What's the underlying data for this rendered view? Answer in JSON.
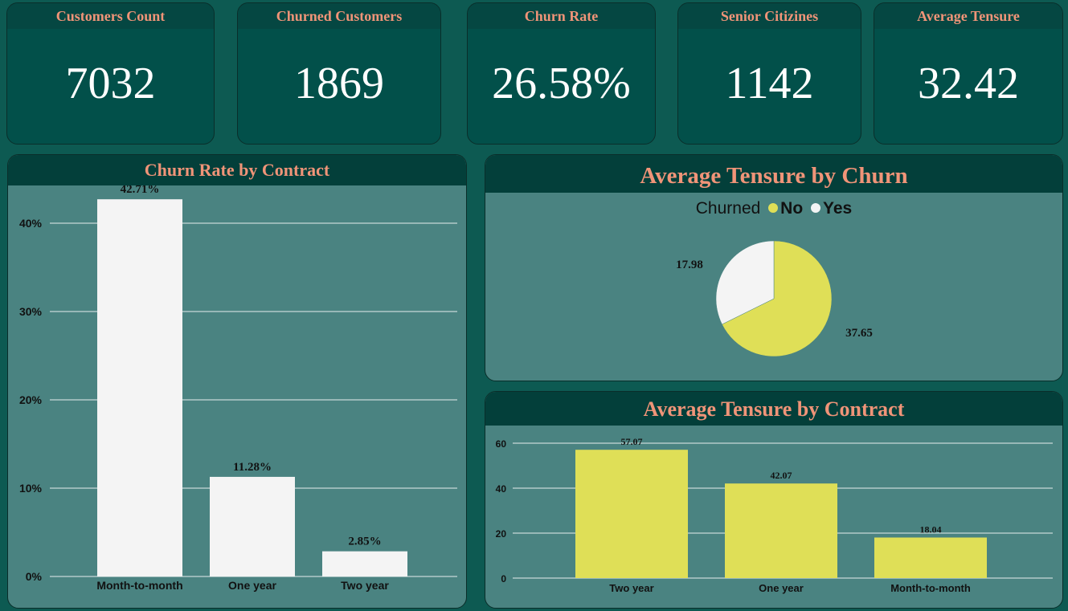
{
  "colors": {
    "background": "#0d5a52",
    "kpi_fill": "#02504a",
    "header_fill": "#033f3a",
    "panel_fill": "#4a8381",
    "accent_title": "#f09478",
    "bar_white": "#f4f4f4",
    "bar_yellow": "#dfdf57",
    "pie_no": "#dfdf57",
    "pie_yes": "#f4f4f4"
  },
  "kpis": [
    {
      "title": "Customers Count",
      "value": "7032"
    },
    {
      "title": "Churned Customers",
      "value": "1869"
    },
    {
      "title": "Churn Rate",
      "value": "26.58%"
    },
    {
      "title": "Senior Citizines",
      "value": "1142"
    },
    {
      "title": "Average Tensure",
      "value": "32.42"
    }
  ],
  "chart_data": [
    {
      "type": "bar",
      "title": "Churn Rate by Contract",
      "categories": [
        "Month-to-month",
        "One year",
        "Two year"
      ],
      "values": [
        42.71,
        11.28,
        2.85
      ],
      "data_labels": [
        "42.71%",
        "11.28%",
        "2.85%"
      ],
      "yticks": [
        0,
        10,
        20,
        30,
        40
      ],
      "ytick_labels": [
        "0%",
        "10%",
        "20%",
        "30%",
        "40%"
      ],
      "ylim": [
        0,
        44
      ],
      "xlabel": "",
      "ylabel": "",
      "grid": true,
      "color": "#f4f4f4"
    },
    {
      "type": "pie",
      "title": "Average Tensure by Churn",
      "legend_title": "Churned",
      "legend_position": "top-center",
      "slices": [
        {
          "label": "No",
          "value": 37.65,
          "data_label": "37.65",
          "color": "#dfdf57"
        },
        {
          "label": "Yes",
          "value": 17.98,
          "data_label": "17.98",
          "color": "#f4f4f4"
        }
      ]
    },
    {
      "type": "bar",
      "title": "Average Tensure by Contract",
      "categories": [
        "Two year",
        "One year",
        "Month-to-month"
      ],
      "values": [
        57.07,
        42.07,
        18.04
      ],
      "data_labels": [
        "57.07",
        "42.07",
        "18.04"
      ],
      "yticks": [
        0,
        20,
        40,
        60
      ],
      "ytick_labels": [
        "0",
        "20",
        "40",
        "60"
      ],
      "ylim": [
        0,
        60
      ],
      "xlabel": "",
      "ylabel": "",
      "grid": true,
      "color": "#dfdf57"
    }
  ]
}
